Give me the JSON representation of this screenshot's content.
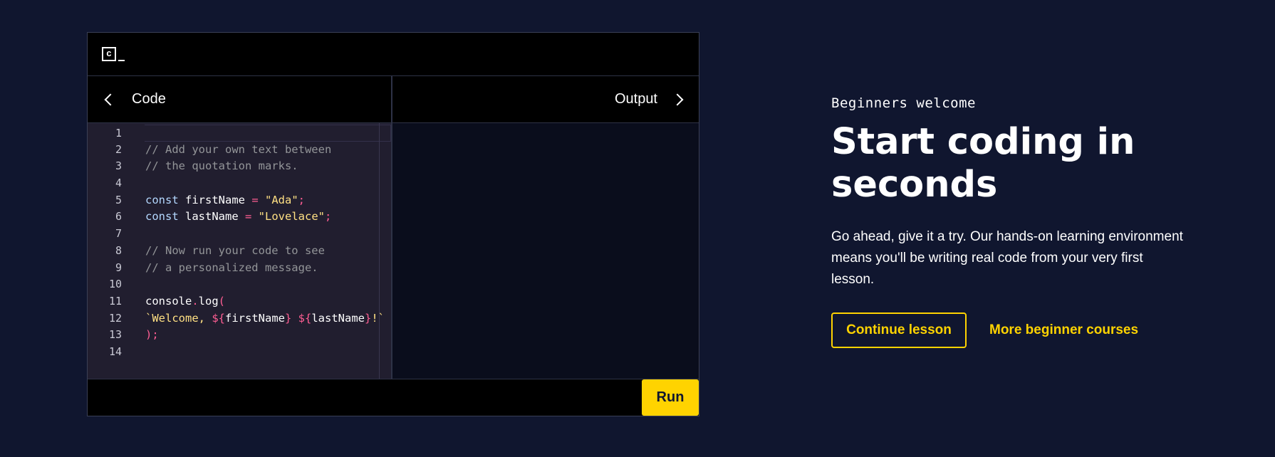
{
  "editor": {
    "logo_letter": "c",
    "code_tab_label": "Code",
    "output_tab_label": "Output",
    "run_label": "Run",
    "lines": [
      {
        "n": "1",
        "tokens": []
      },
      {
        "n": "2",
        "tokens": [
          {
            "t": "// Add your own text between",
            "c": "com"
          }
        ]
      },
      {
        "n": "3",
        "tokens": [
          {
            "t": "// the quotation marks.",
            "c": "com"
          }
        ]
      },
      {
        "n": "4",
        "tokens": []
      },
      {
        "n": "5",
        "tokens": [
          {
            "t": "const ",
            "c": "kw"
          },
          {
            "t": "firstName ",
            "c": "var"
          },
          {
            "t": "= ",
            "c": "op"
          },
          {
            "t": "\"Ada\"",
            "c": "str"
          },
          {
            "t": ";",
            "c": "op"
          }
        ]
      },
      {
        "n": "6",
        "tokens": [
          {
            "t": "const ",
            "c": "kw"
          },
          {
            "t": "lastName ",
            "c": "var"
          },
          {
            "t": "= ",
            "c": "op"
          },
          {
            "t": "\"Lovelace\"",
            "c": "str"
          },
          {
            "t": ";",
            "c": "op"
          }
        ]
      },
      {
        "n": "7",
        "tokens": []
      },
      {
        "n": "8",
        "tokens": [
          {
            "t": "// Now run your code to see",
            "c": "com"
          }
        ]
      },
      {
        "n": "9",
        "tokens": [
          {
            "t": "// a personalized message.",
            "c": "com"
          }
        ]
      },
      {
        "n": "10",
        "tokens": []
      },
      {
        "n": "11",
        "tokens": [
          {
            "t": "console",
            "c": "fn"
          },
          {
            "t": ".",
            "c": "op"
          },
          {
            "t": "log",
            "c": "fn"
          },
          {
            "t": "(",
            "c": "op"
          }
        ]
      },
      {
        "n": "12",
        "tokens": [
          {
            "t": "`Welcome, ",
            "c": "str"
          },
          {
            "t": "${",
            "c": "op"
          },
          {
            "t": "firstName",
            "c": "var"
          },
          {
            "t": "} ",
            "c": "op"
          },
          {
            "t": "${",
            "c": "op"
          },
          {
            "t": "lastName",
            "c": "var"
          },
          {
            "t": "}",
            "c": "op"
          },
          {
            "t": "!`",
            "c": "str"
          }
        ]
      },
      {
        "n": "13",
        "tokens": [
          {
            "t": ");",
            "c": "op"
          }
        ]
      },
      {
        "n": "14",
        "tokens": []
      }
    ]
  },
  "promo": {
    "eyebrow": "Beginners welcome",
    "headline_line1": "Start coding in",
    "headline_line2": "seconds",
    "description": "Go ahead, give it a try. Our hands-on learning environment means you'll be writing real code from your very first lesson.",
    "continue_label": "Continue lesson",
    "more_label": "More beginner courses"
  },
  "colors": {
    "background": "#10162f",
    "accent": "#ffd300"
  }
}
